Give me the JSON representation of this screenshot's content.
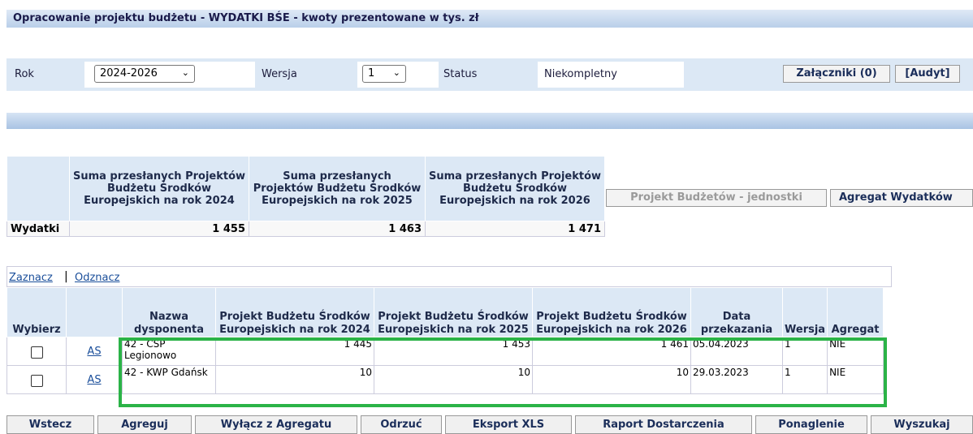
{
  "title": "Opracowanie projektu budżetu - WYDATKI BŚE - kwoty prezentowane w tys. zł",
  "filters": {
    "rok_label": "Rok",
    "rok_value": "2024-2026",
    "wersja_label": "Wersja",
    "wersja_value": "1",
    "status_label": "Status",
    "status_value": "Niekompletny",
    "zalaczniki_button": "Załączniki (0)",
    "audyt_button": "[Audyt]"
  },
  "summary": {
    "headers": [
      "Suma przesłanych Projektów Budżetu Środków Europejskich na rok 2024",
      "Suma przesłanych Projektów Budżetu Środków Europejskich na rok 2025",
      "Suma przesłanych Projektów Budżetu Środków Europejskich na rok 2026"
    ],
    "row_label": "Wydatki",
    "values": [
      "1 455",
      "1 463",
      "1 471"
    ],
    "btn_projekt": "Projekt Budżetów - jednostki",
    "btn_agregat": "Agregat Wydatków"
  },
  "links": {
    "zaznacz": "Zaznacz",
    "separator": "|",
    "odznacz": "Odznacz"
  },
  "grid": {
    "headers": {
      "wybierz": "Wybierz",
      "nazwa": "Nazwa dysponenta",
      "pb2024": "Projekt Budżetu Środków Europejskich na rok 2024",
      "pb2025": "Projekt Budżetu Środków Europejskich na rok 2025",
      "pb2026": "Projekt Budżetu Środków Europejskich na rok 2026",
      "data": "Data przekazania",
      "wersja": "Wersja",
      "agregat": "Agregat"
    },
    "rows": [
      {
        "link": "AS",
        "nazwa": "42 - CSP Legionowo",
        "v2024": "1 445",
        "v2025": "1 453",
        "v2026": "1 461",
        "data": "05.04.2023",
        "wersja": "1",
        "agregat": "NIE"
      },
      {
        "link": "AS",
        "nazwa": "42 - KWP Gdańsk",
        "v2024": "10",
        "v2025": "10",
        "v2026": "10",
        "data": "29.03.2023",
        "wersja": "1",
        "agregat": "NIE"
      }
    ]
  },
  "bottom_buttons": [
    "Wstecz",
    "Agreguj",
    "Wyłącz z Agregatu",
    "Odrzuć",
    "Eksport XLS",
    "Raport Dostarczenia",
    "Ponaglenie",
    "Wyszukaj"
  ],
  "colors": {
    "header_bg": "#dce8f5",
    "highlight_border": "#2bb347",
    "link": "#1a4e9a"
  }
}
